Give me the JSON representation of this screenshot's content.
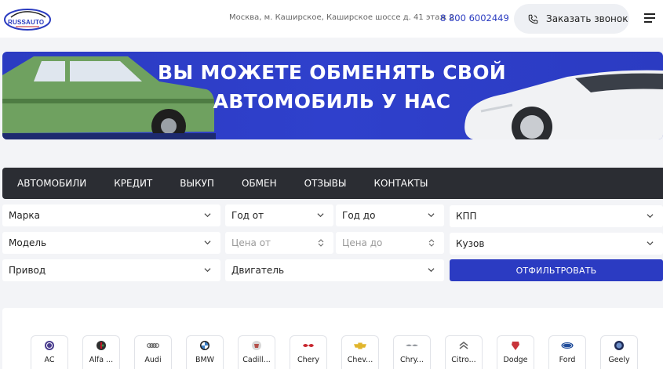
{
  "header": {
    "logo_text": "RUSSAUTO",
    "address": "Москва, м. Каширское, Каширское шоссе д. 41 этаж 2",
    "phone": "8 800 6002449",
    "callback_label": "Заказать звонок"
  },
  "banner": {
    "line1": "ВЫ МОЖЕТЕ ОБМЕНЯТЬ СВОЙ",
    "line2": "АВТОМОБИЛЬ У НАС"
  },
  "nav": {
    "items": [
      "АВТОМОБИЛИ",
      "КРЕДИТ",
      "ВЫКУП",
      "ОБМЕН",
      "ОТЗЫВЫ",
      "КОНТАКТЫ"
    ]
  },
  "filter": {
    "make": "Марка",
    "year_from": "Год от",
    "year_to": "Год до",
    "gearbox": "КПП",
    "model": "Модель",
    "price_from_placeholder": "Цена от",
    "price_to_placeholder": "Цена до",
    "body": "Кузов",
    "drive": "Привод",
    "engine": "Двигатель",
    "submit": "ОТФИЛЬТРОВАТЬ"
  },
  "brands": [
    {
      "name": "AC",
      "icon": "ac-logo-icon"
    },
    {
      "name": "Alfa ...",
      "icon": "alfa-romeo-logo-icon"
    },
    {
      "name": "Audi",
      "icon": "audi-logo-icon"
    },
    {
      "name": "BMW",
      "icon": "bmw-logo-icon"
    },
    {
      "name": "Cadill...",
      "icon": "cadillac-logo-icon"
    },
    {
      "name": "Chery",
      "icon": "chery-logo-icon"
    },
    {
      "name": "Chev...",
      "icon": "chevrolet-logo-icon"
    },
    {
      "name": "Chry...",
      "icon": "chrysler-logo-icon"
    },
    {
      "name": "Citro...",
      "icon": "citroen-logo-icon"
    },
    {
      "name": "Dodge",
      "icon": "dodge-logo-icon"
    },
    {
      "name": "Ford",
      "icon": "ford-logo-icon"
    },
    {
      "name": "Geely",
      "icon": "geely-logo-icon"
    }
  ],
  "colors": {
    "accent": "#2b3bc2",
    "nav_bg": "#2b2d33",
    "page_bg": "#f3f4f7"
  }
}
